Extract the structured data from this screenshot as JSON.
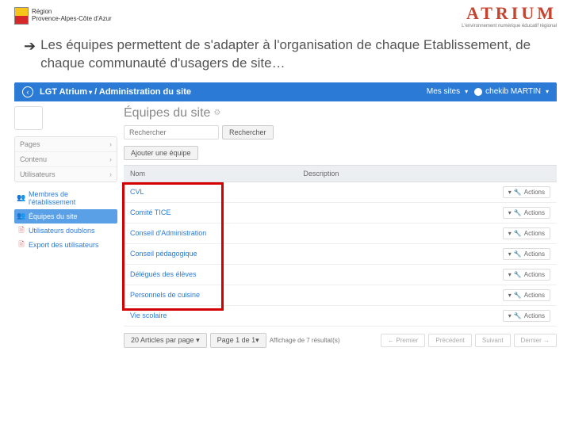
{
  "header": {
    "region_label": "Région",
    "region_name": "Provence-Alpes-Côte d'Azur",
    "atrium": "ATRIUM",
    "atrium_sub": "L'environnement numérique éducatif régional"
  },
  "intro": "Les équipes permettent de s'adapter à l'organisation de chaque Etablissement, de chaque communauté d'usagers de site…",
  "topbar": {
    "crumb1": "LGT Atrium",
    "sep": "/",
    "crumb2": "Administration du site",
    "my_sites": "Mes sites",
    "user": "chekib MARTIN"
  },
  "sidebar": {
    "menu": [
      {
        "label": "Pages"
      },
      {
        "label": "Contenu"
      },
      {
        "label": "Utilisateurs"
      }
    ],
    "submenu": [
      {
        "label": "Membres de l'établissement"
      },
      {
        "label": "Équipes du site"
      },
      {
        "label": "Utilisateurs doublons"
      },
      {
        "label": "Export des utilisateurs"
      }
    ]
  },
  "content": {
    "title": "Équipes du site",
    "search_placeholder": "Rechercher",
    "search_btn": "Rechercher",
    "add_team": "Ajouter une équipe",
    "col_name": "Nom",
    "col_desc": "Description",
    "actions": "Actions",
    "rows": [
      {
        "name": "CVL"
      },
      {
        "name": "Comité TICE"
      },
      {
        "name": "Conseil d'Administration"
      },
      {
        "name": "Conseil pédagogique"
      },
      {
        "name": "Délégués des élèves"
      },
      {
        "name": "Personnels de cuisine"
      },
      {
        "name": "Vie scolaire"
      }
    ]
  },
  "footer": {
    "per_page": "20 Articles par page",
    "page": "Page 1 de 1",
    "results": "Affichage de 7 résultat(s)",
    "first": "← Premier",
    "prev": "Précédent",
    "next": "Suivant",
    "last": "Dernier →"
  }
}
